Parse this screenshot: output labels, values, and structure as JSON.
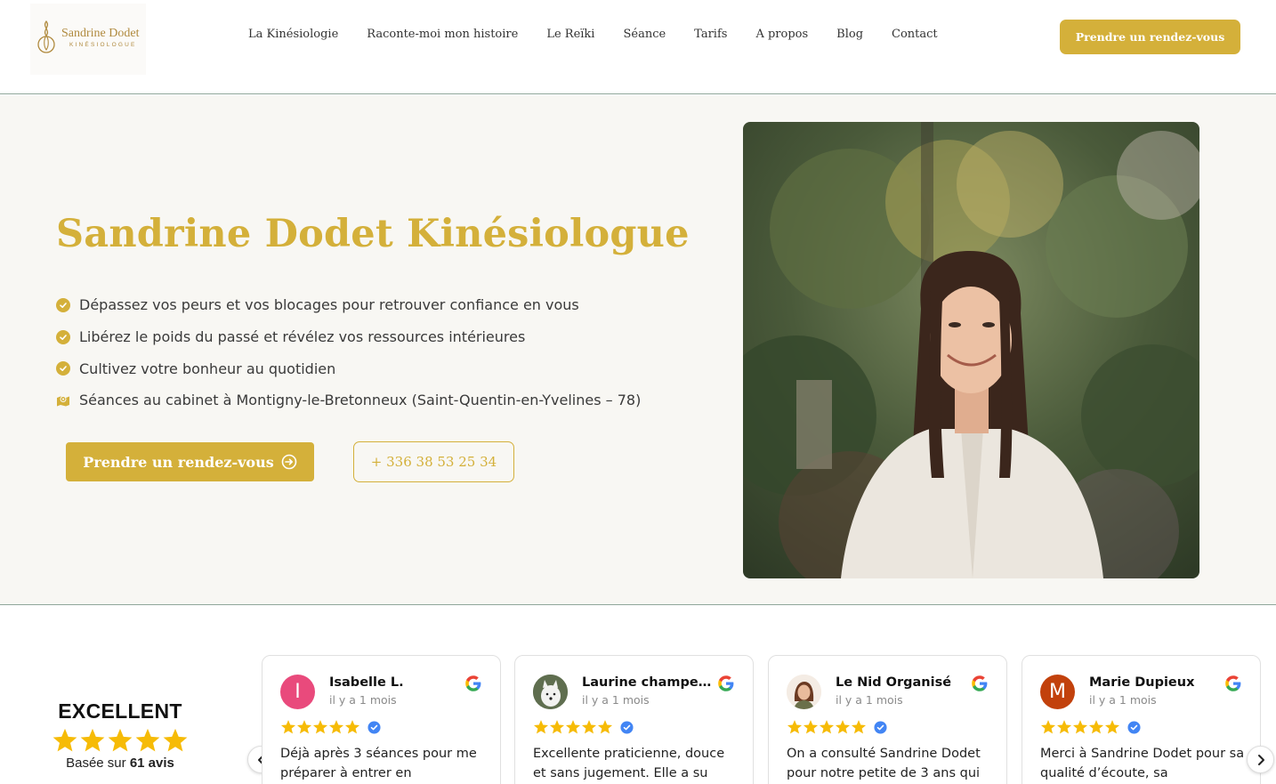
{
  "brand": {
    "name": "Sandrine Dodet",
    "subtitle": "KINÉSIOLOGUE",
    "color": "#d4b03a"
  },
  "nav": {
    "items": [
      {
        "label": "La Kinésiologie"
      },
      {
        "label": "Raconte-moi mon histoire"
      },
      {
        "label": "Le Reïki"
      },
      {
        "label": "Séance"
      },
      {
        "label": "Tarifs"
      },
      {
        "label": "A propos"
      },
      {
        "label": "Blog"
      },
      {
        "label": "Contact"
      }
    ],
    "cta_label": "Prendre un rendez-vous"
  },
  "hero": {
    "title": "Sandrine Dodet Kinésiologue",
    "bullets": [
      {
        "text": "Dépassez vos peurs et vos blocages pour retrouver confiance en vous",
        "icon": "check-circle-icon"
      },
      {
        "text": "Libérez le poids du passé et révélez vos ressources intérieures",
        "icon": "check-circle-icon"
      },
      {
        "text": "Cultivez votre bonheur au quotidien",
        "icon": "check-circle-icon"
      },
      {
        "text": "Séances au cabinet à Montigny-le-Bretonneux (Saint-Quentin-en-Yvelines – 78)",
        "icon": "map-icon"
      }
    ],
    "primary_button": "Prendre un rendez-vous",
    "phone_button": "+ 336 38 53 25 34"
  },
  "reviews": {
    "summary": {
      "title": "EXCELLENT",
      "rating": 5,
      "based_prefix": "Basée sur",
      "count_label": "61 avis"
    },
    "items": [
      {
        "name": "Isabelle L.",
        "date": "il y a 1 mois",
        "rating": 5,
        "avatar_letter": "I",
        "avatar_color": "#e94a7c",
        "text": "Déjà après 3 séances pour me préparer à entrer en"
      },
      {
        "name": "Laurine champenois",
        "date": "il y a 1 mois",
        "rating": 5,
        "avatar_letter": "",
        "avatar_color": "#6b7a5a",
        "text": "Excellente praticienne, douce et sans jugement. Elle a su"
      },
      {
        "name": "Le Nid Organisé",
        "date": "il y a 1 mois",
        "rating": 5,
        "avatar_letter": "",
        "avatar_color": "#f2e6da",
        "text": "On a consulté Sandrine Dodet pour notre petite de 3 ans qui"
      },
      {
        "name": "Marie Dupieux",
        "date": "il y a 1 mois",
        "rating": 5,
        "avatar_letter": "M",
        "avatar_color": "#c2410c",
        "text": "Merci à Sandrine Dodet pour sa qualité d’écoute, sa"
      }
    ]
  }
}
